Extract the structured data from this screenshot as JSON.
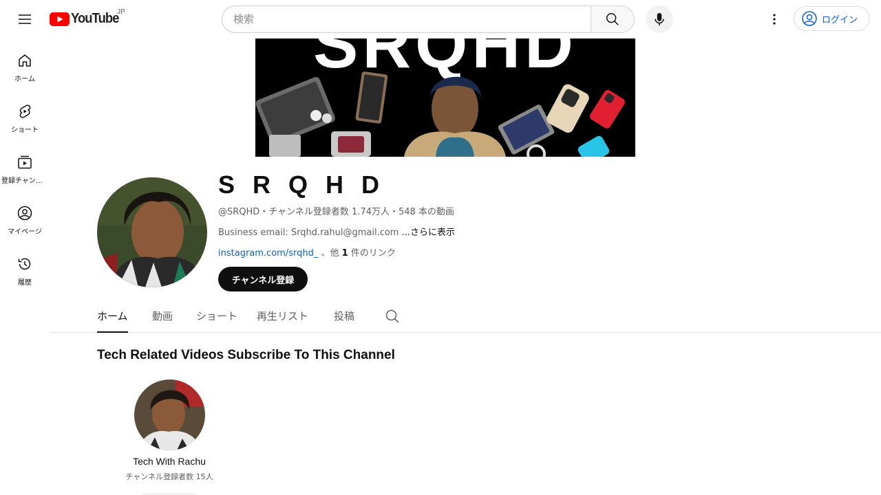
{
  "header": {
    "logo_text": "YouTube",
    "region": "JP",
    "search_placeholder": "検索",
    "login_label": "ログイン"
  },
  "sidebar": {
    "items": [
      {
        "label": "ホーム",
        "icon": "home-icon"
      },
      {
        "label": "ショート",
        "icon": "shorts-icon"
      },
      {
        "label": "登録チャンネル",
        "icon": "subscriptions-icon"
      },
      {
        "label": "マイページ",
        "icon": "user-icon"
      },
      {
        "label": "履歴",
        "icon": "history-icon"
      }
    ]
  },
  "banner": {
    "text": "SRQHD"
  },
  "channel": {
    "name": "S R Q H D",
    "meta": "@SRQHD・チャンネル登録者数 1.74万人・548 本の動画",
    "description": "Business email: Srqhd.rahul@gmail.com ",
    "description_more": "...さらに表示",
    "link_text": "instagram.com/srqhd_",
    "link_suffix_pre": " 、他 ",
    "link_count": "1",
    "link_suffix_post": " 件のリンク",
    "subscribe_label": "チャンネル登録"
  },
  "tabs": [
    {
      "label": "ホーム",
      "active": true
    },
    {
      "label": "動画",
      "active": false
    },
    {
      "label": "ショート",
      "active": false
    },
    {
      "label": "再生リスト",
      "active": false
    },
    {
      "label": "投稿",
      "active": false
    }
  ],
  "section": {
    "title": "Tech Related Videos Subscribe To This Channel",
    "channels": [
      {
        "name": "Tech With Rachu",
        "subs": "チャンネル登録者数 15人"
      }
    ]
  },
  "colors": {
    "accent_link": "#065fd4",
    "logo_red": "#ff0000",
    "button_dark": "#0f0f0f"
  }
}
